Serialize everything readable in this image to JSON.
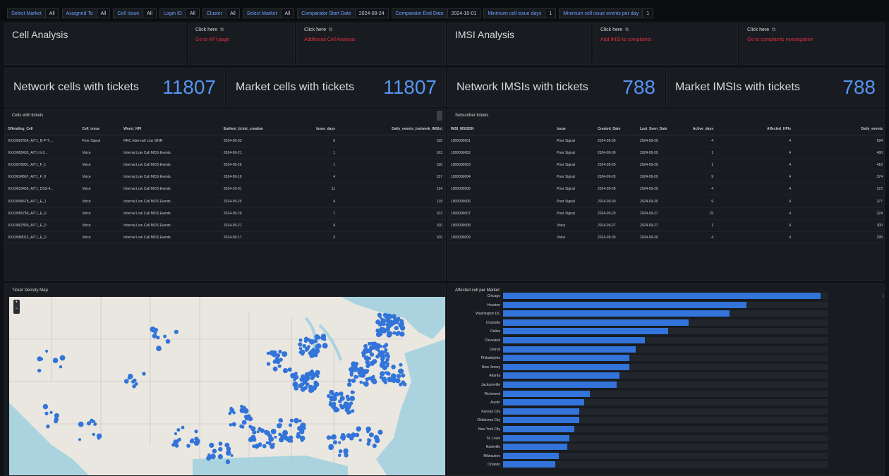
{
  "variables": [
    {
      "label": "Select Market",
      "value": "All"
    },
    {
      "label": "Assigned To",
      "value": "All"
    },
    {
      "label": "Cell Issue",
      "value": "All"
    },
    {
      "label": "Login ID",
      "value": "All"
    },
    {
      "label": "Cluster",
      "value": "All"
    },
    {
      "label": "Select Market",
      "value": "All"
    },
    {
      "label": "Comparator Start Date",
      "value": "2024-08-24"
    },
    {
      "label": "Comparator End Date",
      "value": "2024-10-01"
    },
    {
      "label": "Minimum cell issue days",
      "value": "1"
    },
    {
      "label": "Minimum cell issue events per day",
      "value": "1"
    }
  ],
  "cell_analysis": {
    "title": "Cell Analysis",
    "link1": {
      "top": "Click here",
      "text": "Go to KPI page"
    },
    "link2": {
      "top": "Click here",
      "text": "Additional Cell Analysis"
    }
  },
  "imsi_analysis": {
    "title": "IMSI Analysis",
    "link1": {
      "top": "Click here",
      "text": "Add IMSI to complaints"
    },
    "link2": {
      "top": "Click here",
      "text": "Go to complaints investigation"
    }
  },
  "stats": [
    {
      "title": "Network cells with tickets",
      "value": "11807"
    },
    {
      "title": "Market cells with tickets",
      "value": "11807"
    },
    {
      "title": "Network IMSIs with tickets",
      "value": "788"
    },
    {
      "title": "Market IMSIs with tickets",
      "value": "788"
    }
  ],
  "cells_table": {
    "title": "Cells with tickets",
    "columns": [
      "Offending_Cell",
      "Cell_issue",
      "Worst_KPI",
      "Earliest_ticket_creation",
      "Issue_days",
      "Daily_events_(network_IMSIs)"
    ],
    "rows": [
      [
        "XXX0987654_A/T1_B-P-T-...",
        "Poor Signal",
        "RRC Inter-cell Low SINR",
        "2024-09-03",
        "6",
        "165"
      ],
      [
        "XXX0065432_A/T1-S-2...",
        "Voice",
        "Internal Low Call MOS Events",
        "2024-09-21",
        "1",
        "163"
      ],
      [
        "XXX0078901_A/T1_F_1",
        "Voice",
        "Internal Low Call MOS Events",
        "2024-09-26",
        "1",
        "160"
      ],
      [
        "XXX0034567_A/T1_F_0",
        "Voice",
        "Internal Low Call MOS Events",
        "2024-09-19",
        "4",
        "157"
      ],
      [
        "XXX0023456_A/T1_DSS-4...",
        "Voice",
        "Internal Low Call MOS Events",
        "2024-10-01",
        "11",
        "134"
      ],
      [
        "XXX0045678_A/T1_E_1",
        "Voice",
        "Internal Low Call MOS Events",
        "2024-09-25",
        "4",
        "118"
      ],
      [
        "XXX0056789_A/T1_E_0",
        "Voice",
        "Internal Low Call MOS Events",
        "2024-09-29",
        "1",
        "103"
      ],
      [
        "XXX0067890_A/T1_E_0",
        "Voice",
        "Internal Low Call MOS Events",
        "2024-09-21",
        "4",
        "100"
      ],
      [
        "XXX0089012_A/T1_E_0",
        "Voice",
        "Internal Low Call MOS Events",
        "2024-09-17",
        "3",
        "100"
      ]
    ]
  },
  "imsi_table": {
    "title": "Subscriber tickets",
    "columns": [
      "IMSI_MSISDN",
      "Issue",
      "Created_Date",
      "Last_Seen_Date",
      "Active_days",
      "Affected_KPIs",
      "Daily_events"
    ],
    "rows": [
      [
        "1900000001",
        "Poor Signal",
        "2024-09-30",
        "2024-09-30",
        "4",
        "4",
        "594"
      ],
      [
        "1900000002",
        "Poor Signal",
        "2024-09-30",
        "2024-09-30",
        "1",
        "4",
        "490"
      ],
      [
        "1900000003",
        "Poor Signal",
        "2024-09-29",
        "2024-09-29",
        "1",
        "4",
        "416"
      ],
      [
        "1900000004",
        "Poor Signal",
        "2024-09-29",
        "2024-09-30",
        "9",
        "4",
        "374"
      ],
      [
        "1900000005",
        "Poor Signal",
        "2024-09-28",
        "2024-09-29",
        "4",
        "4",
        "372"
      ],
      [
        "1900000006",
        "Poor Signal",
        "2024-09-30",
        "2024-09-30",
        "9",
        "4",
        "377"
      ],
      [
        "1900000007",
        "Poor Signal",
        "2024-09-29",
        "2024-09-27",
        "15",
        "4",
        "324"
      ],
      [
        "1900000008",
        "Voice",
        "2024-09-27",
        "2024-09-27",
        "1",
        "4",
        "300"
      ],
      [
        "1900000009",
        "Voice",
        "2024-09-30",
        "2024-09-30",
        "4",
        "4",
        "295"
      ]
    ]
  },
  "map": {
    "title": "Ticket Density Map",
    "zoom_in": "+",
    "zoom_out": "−"
  },
  "bar_panel": {
    "title": "Affected cell per Market"
  },
  "chart_data": {
    "type": "bar",
    "orientation": "horizontal",
    "title": "Affected cell per Market",
    "categories": [
      "Chicago",
      "Houston",
      "Washington DC",
      "Charlotte",
      "Dallas",
      "Cleveland",
      "Detroit",
      "Philadelphia",
      "New Jersey",
      "Atlanta",
      "Jacksonville",
      "Richmond",
      "Austin",
      "Kansas City",
      "Oklahoma City",
      "New York City",
      "St. Louis",
      "Nashville",
      "Milwaukee",
      "Orlando"
    ],
    "values": [
      1076,
      826,
      767,
      630,
      560,
      480,
      450,
      428,
      428,
      394,
      386,
      293,
      276,
      258,
      258,
      242,
      224,
      218,
      189,
      176
    ],
    "xlim": [
      0,
      1100
    ]
  }
}
